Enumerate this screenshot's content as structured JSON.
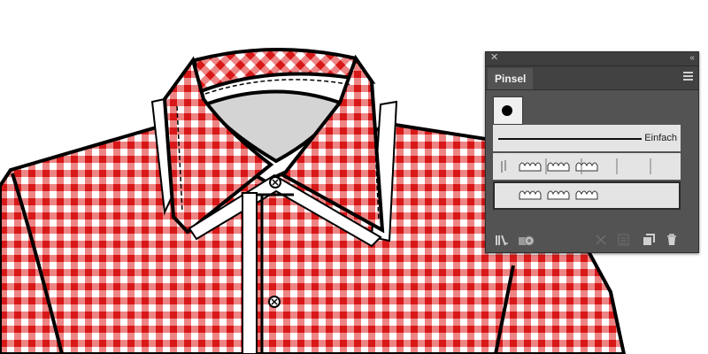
{
  "panel": {
    "tab_label": "Pinsel",
    "brushes": [
      {
        "name": "Einfach"
      }
    ]
  },
  "colors": {
    "gingham_red": "#e02020",
    "collar_gray": "#d4d4d4",
    "panel_bg": "#535353"
  },
  "icons": {
    "panel_close": "close-icon",
    "panel_collapse": "double-chevron-icon",
    "panel_menu": "hamburger-menu-icon",
    "bottom": [
      "brush-library-icon",
      "brush-library-panel-icon",
      "remove-stroke-icon",
      "brush-options-icon",
      "new-brush-icon",
      "trash-icon"
    ]
  }
}
